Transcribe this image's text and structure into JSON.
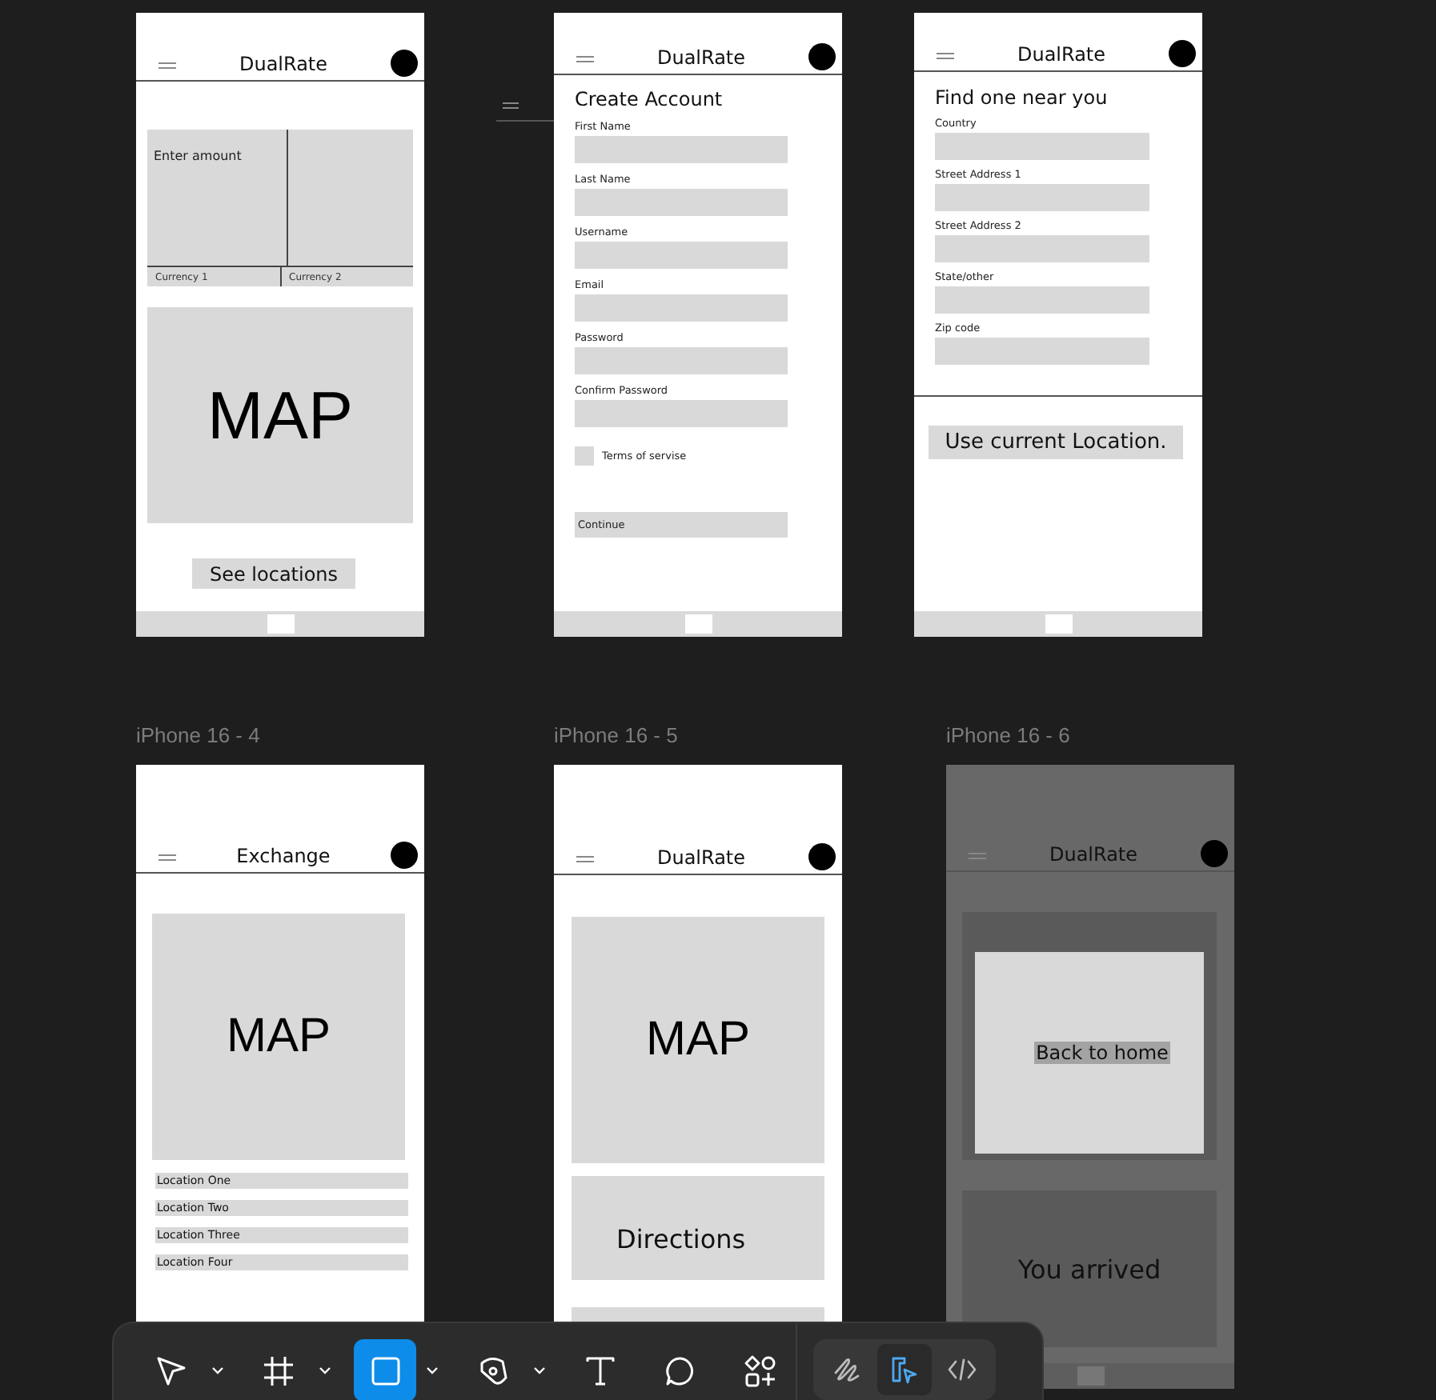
{
  "canvas": {
    "frames": [
      {
        "kind": "converter",
        "dimmed": false,
        "header": {
          "title": "DualRate"
        },
        "amount_placeholder": "Enter amount",
        "currencies": [
          "Currency 1",
          "Currency 2"
        ],
        "map": "MAP",
        "button": "See locations"
      },
      {
        "kind": "signup",
        "dimmed": false,
        "header": {
          "title": "DualRate"
        },
        "heading": "Create Account",
        "fields": [
          "First Name",
          "Last Name",
          "Username",
          "Email",
          "Password",
          "Confirm Password"
        ],
        "terms": {
          "label": "Terms of servise",
          "checked": false
        },
        "button": "Continue"
      },
      {
        "kind": "find",
        "dimmed": false,
        "header": {
          "title": "DualRate"
        },
        "heading": "Find one near you",
        "fields": [
          "Country",
          "Street Address 1",
          "Street Address 2",
          "State/other",
          "Zip code"
        ],
        "button": "Use current Location."
      },
      {
        "kind": "locations",
        "label": "iPhone 16 - 4",
        "dimmed": false,
        "header": {
          "title": "Exchange"
        },
        "map": "MAP",
        "locations": [
          "Location One",
          "Location Two",
          "Location Three",
          "Location Four"
        ]
      },
      {
        "kind": "directions",
        "label": "iPhone 16 - 5",
        "dimmed": false,
        "header": {
          "title": "DualRate"
        },
        "map": "MAP",
        "directions": "Directions"
      },
      {
        "kind": "arrived",
        "label": "iPhone 16 - 6",
        "dimmed": true,
        "header": {
          "title": "DualRate"
        },
        "button": "Back to home",
        "message": "You arrived"
      }
    ]
  },
  "toolbar": {
    "tools": [
      {
        "kind": "move",
        "selected": false,
        "dropdown": true
      },
      {
        "kind": "frame",
        "selected": false,
        "dropdown": true
      },
      {
        "kind": "rectangle",
        "selected": true,
        "dropdown": true
      },
      {
        "kind": "pen",
        "selected": false,
        "dropdown": true
      },
      {
        "kind": "text",
        "selected": false,
        "dropdown": false
      },
      {
        "kind": "comment",
        "selected": false,
        "dropdown": false
      },
      {
        "kind": "assets",
        "selected": false,
        "dropdown": false
      }
    ],
    "modes": [
      {
        "kind": "draw",
        "selected": false
      },
      {
        "kind": "design",
        "selected": true
      },
      {
        "kind": "code",
        "selected": false
      }
    ]
  }
}
